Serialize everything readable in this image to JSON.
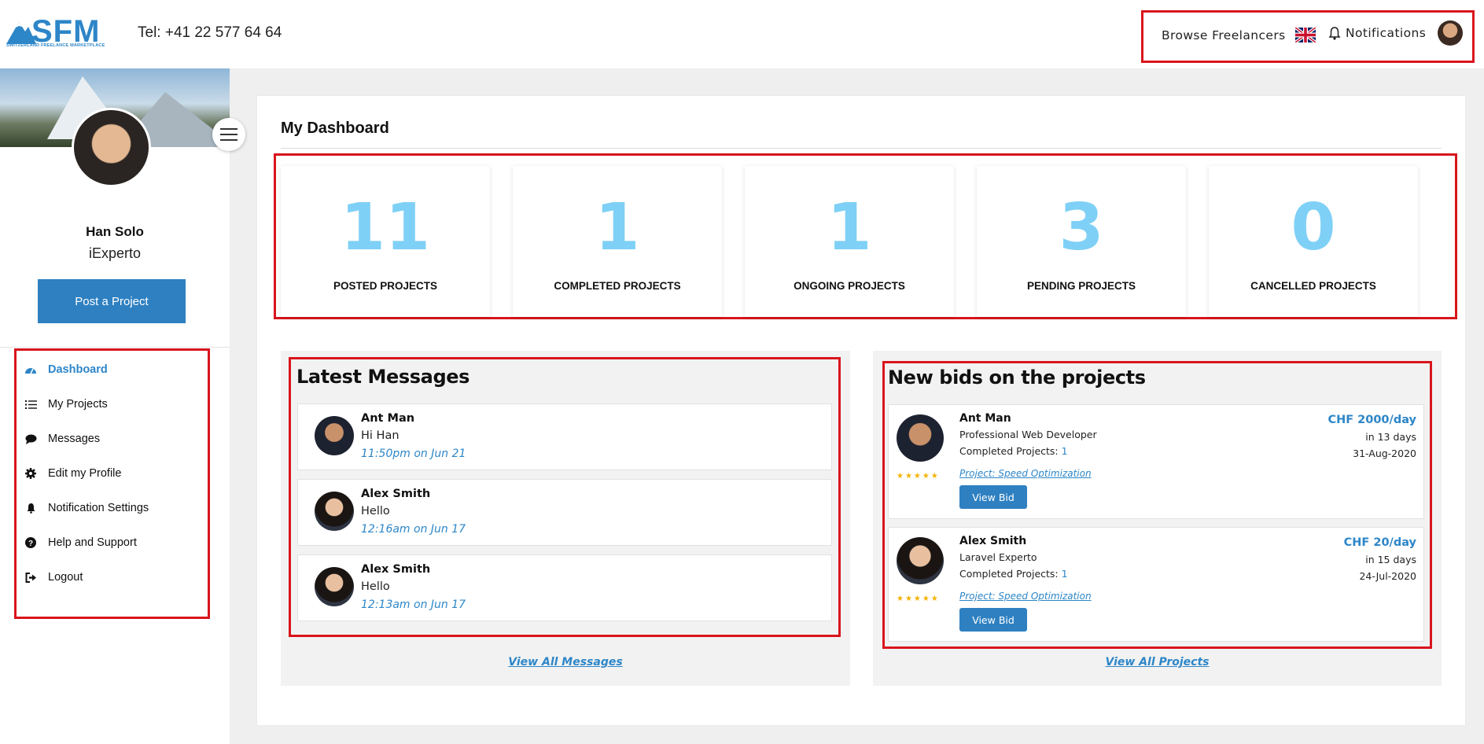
{
  "brand": {
    "logo_text": "SFM",
    "logo_subtitle": "SWITZERLAND FREELANCE MARKETPLACE",
    "accent": "#2d86c8"
  },
  "header": {
    "tel": "Tel: +41 22 577 64 64",
    "browse_label": "Browse Freelancers",
    "language_icon": "uk-flag-icon",
    "notifications_label": "Notifications"
  },
  "sidebar": {
    "user_name": "Han Solo",
    "user_role": "iExperto",
    "post_project_label": "Post a Project",
    "items": [
      {
        "label": "Dashboard",
        "icon": "dashboard-icon",
        "active": true
      },
      {
        "label": "My Projects",
        "icon": "list-icon"
      },
      {
        "label": "Messages",
        "icon": "chat-icon"
      },
      {
        "label": "Edit my Profile",
        "icon": "gear-icon"
      },
      {
        "label": "Notification Settings",
        "icon": "bell-icon"
      },
      {
        "label": "Help and Support",
        "icon": "question-icon"
      },
      {
        "label": "Logout",
        "icon": "logout-icon"
      }
    ]
  },
  "dashboard": {
    "title": "My Dashboard",
    "stats": [
      {
        "value": "11",
        "label": "POSTED PROJECTS"
      },
      {
        "value": "1",
        "label": "COMPLETED PROJECTS"
      },
      {
        "value": "1",
        "label": "ONGOING PROJECTS"
      },
      {
        "value": "3",
        "label": "PENDING PROJECTS"
      },
      {
        "value": "0",
        "label": "CANCELLED PROJECTS"
      }
    ]
  },
  "messages": {
    "title": "Latest Messages",
    "items": [
      {
        "name": "Ant Man",
        "text": "Hi Han",
        "time": "11:50pm on Jun 21"
      },
      {
        "name": "Alex Smith",
        "text": "Hello",
        "time": "12:16am on Jun 17"
      },
      {
        "name": "Alex Smith",
        "text": "Hello",
        "time": "12:13am on Jun 17"
      }
    ],
    "view_all": "View All Messages"
  },
  "bids": {
    "title": "New bids on the projects",
    "items": [
      {
        "name": "Ant Man",
        "title": "Professional Web Developer",
        "completed_label": "Completed Projects:",
        "completed": "1",
        "project": "Project: Speed Optimization",
        "button": "View Bid",
        "rate": "CHF 2000/day",
        "days": "in 13 days",
        "date": "31-Aug-2020",
        "stars": "★★★★★"
      },
      {
        "name": "Alex Smith",
        "title": "Laravel Experto",
        "completed_label": "Completed Projects:",
        "completed": "1",
        "project": "Project: Speed Optimization",
        "button": "View Bid",
        "rate": "CHF 20/day",
        "days": "in 15 days",
        "date": "24-Jul-2020",
        "stars": "★★★★★"
      }
    ],
    "view_all": "View All Projects"
  }
}
